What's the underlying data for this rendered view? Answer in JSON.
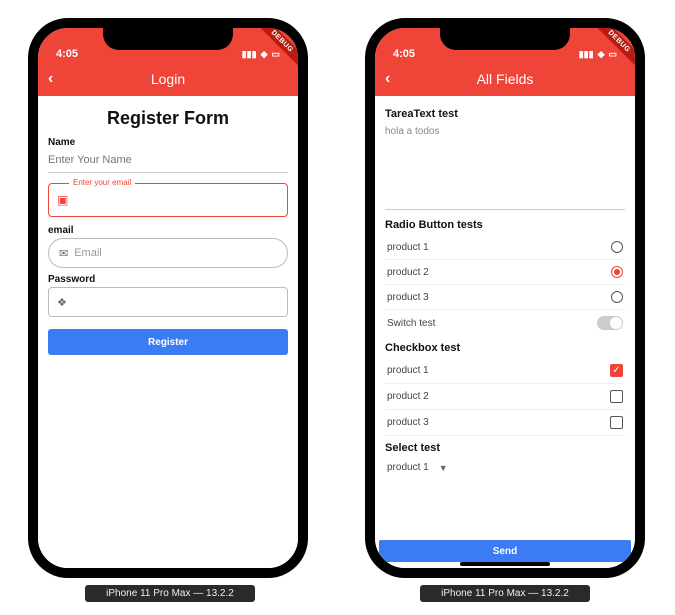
{
  "status": {
    "time": "4:05",
    "debug": "DEBUG"
  },
  "caption": "iPhone 11 Pro Max — 13.2.2",
  "left": {
    "header": {
      "title": "Login"
    },
    "form": {
      "title": "Register Form",
      "name": {
        "label": "Name",
        "placeholder": "Enter Your Name"
      },
      "outlined": {
        "floating": "Enter your email"
      },
      "email": {
        "label": "email",
        "placeholder": "Email"
      },
      "password": {
        "label": "Password"
      },
      "submit": "Register"
    }
  },
  "right": {
    "header": {
      "title": "All Fields"
    },
    "textarea": {
      "label": "TareaText test",
      "value": "hola a todos"
    },
    "radio": {
      "label": "Radio Button tests",
      "options": [
        "product 1",
        "product 2",
        "product 3"
      ],
      "selected": 1
    },
    "switch": {
      "label": "Switch test",
      "value": false
    },
    "checkbox": {
      "label": "Checkbox test",
      "options": [
        "product 1",
        "product 2",
        "product 3"
      ],
      "checked": [
        true,
        false,
        false
      ]
    },
    "select": {
      "label": "Select test",
      "value": "product 1"
    },
    "submit": "Send"
  }
}
